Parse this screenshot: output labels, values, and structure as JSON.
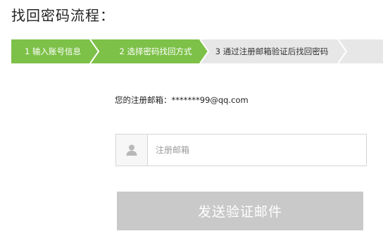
{
  "header": {
    "title": "找回密码流程："
  },
  "steps": [
    {
      "label": "1 输入账号信息",
      "state": "done"
    },
    {
      "label": "2 选择密码找回方式",
      "state": "current"
    },
    {
      "label": "3 通过注册邮箱验证后找回密码",
      "state": "pending"
    }
  ],
  "colors": {
    "step_active": "#7dc149",
    "step_pending": "#e7e7e7",
    "button_disabled": "#c9c9c9"
  },
  "form": {
    "email_label": "您的注册邮箱：",
    "email_value": "*******99@qq.com",
    "email_placeholder": "注册邮箱",
    "email_input_icon": "user-icon",
    "send_button_label": "发送验证邮件",
    "send_button_enabled": false
  }
}
